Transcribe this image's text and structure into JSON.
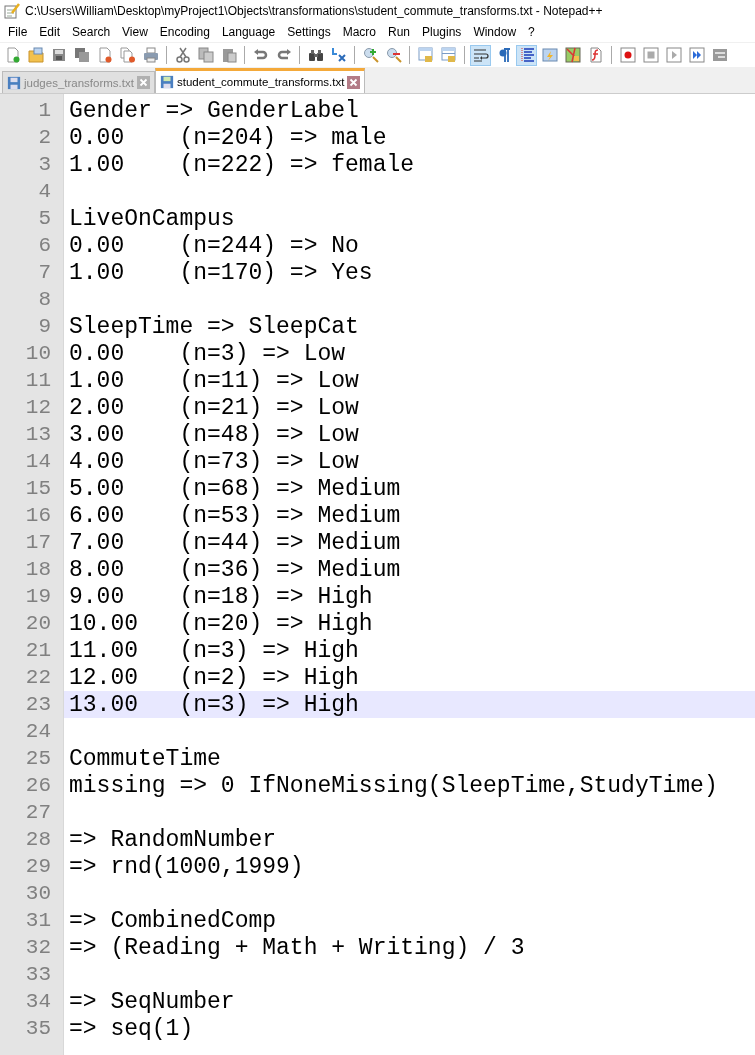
{
  "window": {
    "title": "C:\\Users\\William\\Desktop\\myProject1\\Objects\\transformations\\student_commute_transforms.txt - Notepad++"
  },
  "menu": [
    "File",
    "Edit",
    "Search",
    "View",
    "Encoding",
    "Language",
    "Settings",
    "Macro",
    "Run",
    "Plugins",
    "Window",
    "?"
  ],
  "toolbar": [
    {
      "kind": "new",
      "selected": false
    },
    {
      "kind": "open",
      "selected": false
    },
    {
      "kind": "save",
      "selected": false
    },
    {
      "kind": "save-all",
      "selected": false
    },
    {
      "kind": "close",
      "selected": false
    },
    {
      "kind": "close-all",
      "selected": false
    },
    {
      "kind": "print",
      "selected": false
    },
    {
      "kind": "sep"
    },
    {
      "kind": "cut",
      "selected": false
    },
    {
      "kind": "copy",
      "selected": false
    },
    {
      "kind": "paste",
      "selected": false
    },
    {
      "kind": "sep"
    },
    {
      "kind": "undo",
      "selected": false
    },
    {
      "kind": "redo",
      "selected": false
    },
    {
      "kind": "sep"
    },
    {
      "kind": "find",
      "selected": false
    },
    {
      "kind": "replace",
      "selected": false
    },
    {
      "kind": "sep"
    },
    {
      "kind": "zoom-in",
      "selected": false
    },
    {
      "kind": "zoom-out",
      "selected": false
    },
    {
      "kind": "sep"
    },
    {
      "kind": "sync-v",
      "selected": false
    },
    {
      "kind": "sync-h",
      "selected": false
    },
    {
      "kind": "sep"
    },
    {
      "kind": "wrap",
      "selected": true
    },
    {
      "kind": "all-chars",
      "selected": false
    },
    {
      "kind": "indent-guide",
      "selected": true
    },
    {
      "kind": "udl",
      "selected": false
    },
    {
      "kind": "map",
      "selected": false
    },
    {
      "kind": "function-list",
      "selected": false
    },
    {
      "kind": "sep"
    },
    {
      "kind": "record",
      "selected": false
    },
    {
      "kind": "stop",
      "selected": false
    },
    {
      "kind": "play",
      "selected": false
    },
    {
      "kind": "play-multi",
      "selected": false
    },
    {
      "kind": "save-macro",
      "selected": false
    }
  ],
  "tabs": [
    {
      "label": "judges_transforms.txt",
      "selected": false
    },
    {
      "label": "student_commute_transforms.txt",
      "selected": true
    }
  ],
  "editor": {
    "lines": [
      {
        "number": "1",
        "text": "Gender => GenderLabel",
        "current": false
      },
      {
        "number": "2",
        "text": "0.00    (n=204) => male",
        "current": false
      },
      {
        "number": "3",
        "text": "1.00    (n=222) => female",
        "current": false
      },
      {
        "number": "4",
        "current": false
      },
      {
        "number": "5",
        "text": "LiveOnCampus",
        "current": false
      },
      {
        "number": "6",
        "text": "0.00    (n=244) => No",
        "current": false
      },
      {
        "number": "7",
        "text": "1.00    (n=170) => Yes",
        "current": false
      },
      {
        "number": "8",
        "current": false
      },
      {
        "number": "9",
        "text": "SleepTime => SleepCat",
        "current": false
      },
      {
        "number": "10",
        "text": "0.00    (n=3) => Low",
        "current": false
      },
      {
        "number": "11",
        "text": "1.00    (n=11) => Low",
        "current": false
      },
      {
        "number": "12",
        "text": "2.00    (n=21) => Low",
        "current": false
      },
      {
        "number": "13",
        "text": "3.00    (n=48) => Low",
        "current": false
      },
      {
        "number": "14",
        "text": "4.00    (n=73) => Low",
        "current": false
      },
      {
        "number": "15",
        "text": "5.00    (n=68) => Medium",
        "current": false
      },
      {
        "number": "16",
        "text": "6.00    (n=53) => Medium",
        "current": false
      },
      {
        "number": "17",
        "text": "7.00    (n=44) => Medium",
        "current": false
      },
      {
        "number": "18",
        "text": "8.00    (n=36) => Medium",
        "current": false
      },
      {
        "number": "19",
        "text": "9.00    (n=18) => High",
        "current": false
      },
      {
        "number": "20",
        "text": "10.00   (n=20) => High",
        "current": false
      },
      {
        "number": "21",
        "text": "11.00   (n=3) => High",
        "current": false
      },
      {
        "number": "22",
        "text": "12.00   (n=2) => High",
        "current": false
      },
      {
        "number": "23",
        "text": "13.00   (n=3) => High",
        "current": true
      },
      {
        "number": "24",
        "current": false
      },
      {
        "number": "25",
        "text": "CommuteTime",
        "current": false
      },
      {
        "number": "26",
        "text": "missing => 0 IfNoneMissing(SleepTime,StudyTime)",
        "current": false
      },
      {
        "number": "27",
        "current": false
      },
      {
        "number": "28",
        "text": "=> RandomNumber",
        "current": false
      },
      {
        "number": "29",
        "text": "=> rnd(1000,1999)",
        "current": false
      },
      {
        "number": "30",
        "current": false
      },
      {
        "number": "31",
        "text": "=> CombinedComp",
        "current": false
      },
      {
        "number": "32",
        "text": "=> (Reading + Math + Writing) / 3",
        "current": false
      },
      {
        "number": "33",
        "current": false
      },
      {
        "number": "34",
        "text": "=> SeqNumber",
        "current": false
      },
      {
        "number": "35",
        "text": "=> seq(1)",
        "current": false
      }
    ]
  }
}
